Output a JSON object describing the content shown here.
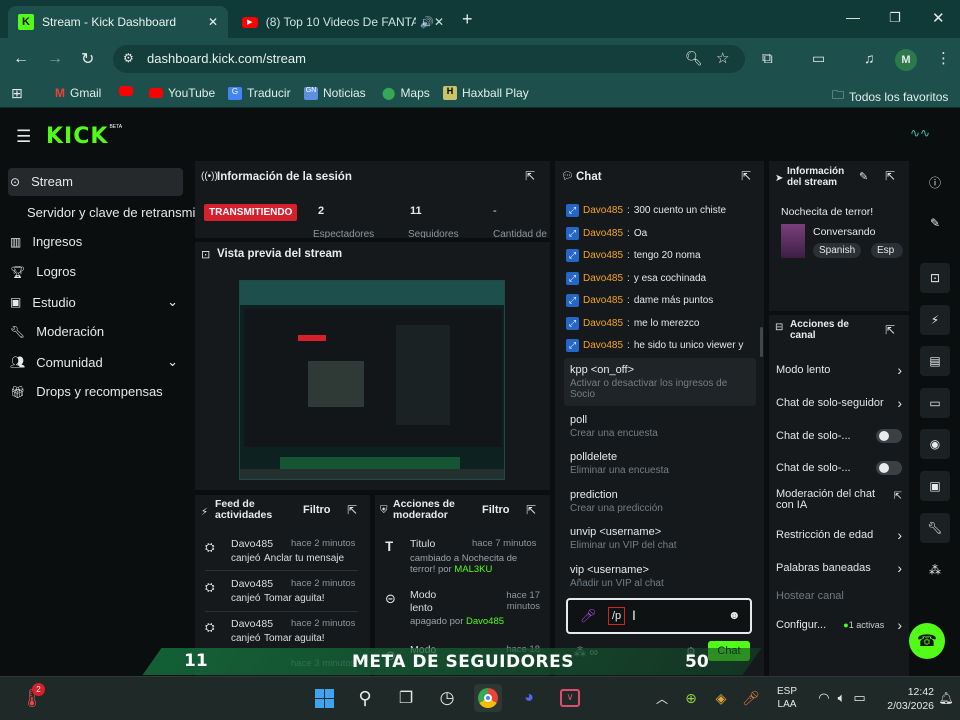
{
  "browser": {
    "tabs": [
      {
        "title": "Stream - Kick Dashboard"
      },
      {
        "title": "(8) Top 10 Videos De FANTA"
      }
    ],
    "url": "dashboard.kick.com/stream",
    "profile_initial": "M",
    "bookmarks": [
      "Gmail",
      "YouTube",
      "Traducir",
      "Noticias",
      "Maps",
      "Haxball Play"
    ],
    "all_bookmarks_label": "Todos los favoritos"
  },
  "kick": {
    "logo": "KICK",
    "logo_badge": "BETA",
    "sidebar": {
      "items": [
        {
          "label": "Stream",
          "icon": "play-icon"
        },
        {
          "label": "Servidor y clave de retransmisión",
          "icon": ""
        },
        {
          "label": "Ingresos",
          "icon": "chart-icon"
        },
        {
          "label": "Logros",
          "icon": "trophy-icon"
        },
        {
          "label": "Estudio",
          "icon": "video-icon"
        },
        {
          "label": "Moderación",
          "icon": "wrench-icon"
        },
        {
          "label": "Comunidad",
          "icon": "people-icon"
        },
        {
          "label": "Drops y recompensas",
          "icon": "gift-icon"
        }
      ]
    },
    "session": {
      "title": "Información de la sesión",
      "status": "TRANSMITIENDO",
      "stats": [
        {
          "value": "2",
          "label": "Espectadores"
        },
        {
          "value": "11",
          "label": "Seguidores"
        },
        {
          "value": "-",
          "label": "Cantidad de"
        }
      ]
    },
    "preview": {
      "title": "Vista previa del stream"
    },
    "chat": {
      "title": "Chat",
      "messages": [
        {
          "user": "Davo485",
          "text": "300 cuento un chiste"
        },
        {
          "user": "Davo485",
          "text": "Oa"
        },
        {
          "user": "Davo485",
          "text": "tengo 20 noma"
        },
        {
          "user": "Davo485",
          "text": "y esa cochinada"
        },
        {
          "user": "Davo485",
          "text": "dame más puntos"
        },
        {
          "user": "Davo485",
          "text": "me lo merezco"
        },
        {
          "user": "Davo485",
          "text": "he sido tu unico viewer y"
        }
      ],
      "commands": [
        {
          "name": "kpp <on_off>",
          "desc": "Activar o desactivar los ingresos de Socio"
        },
        {
          "name": "poll",
          "desc": "Crear una encuesta"
        },
        {
          "name": "polldelete",
          "desc": "Eliminar una encuesta"
        },
        {
          "name": "prediction",
          "desc": "Crear una predicción"
        },
        {
          "name": "unvip <username>",
          "desc": "Eliminar un VIP del chat"
        },
        {
          "name": "vip <username>",
          "desc": "Añadir un VIP al chat"
        }
      ],
      "input_value": "/p",
      "send_label": "Chat"
    },
    "stream_info": {
      "title": "Información del stream",
      "stream_title": "Nochecita de terror!",
      "category": "Conversando",
      "tags": [
        "Spanish",
        "Esp"
      ]
    },
    "channel_actions": {
      "title": "Acciones de canal",
      "items": [
        {
          "label": "Modo lento",
          "control": "chevron"
        },
        {
          "label": "Chat de solo-seguidores",
          "control": "chevron"
        },
        {
          "label": "Chat de solo-...",
          "control": "toggle"
        },
        {
          "label": "Chat de solo-...",
          "control": "toggle"
        },
        {
          "label": "Moderación del chat con IA",
          "control": "external"
        },
        {
          "label": "Restricción de edad",
          "control": "chevron"
        },
        {
          "label": "Palabras baneadas",
          "control": "chevron"
        },
        {
          "label": "Hostear canal",
          "control": "none"
        },
        {
          "label": "Configur...",
          "control": "chevron",
          "badge": "1 activas"
        }
      ]
    },
    "activity_feed": {
      "title": "Feed de actividades",
      "filter": "Filtro",
      "items": [
        {
          "user": "Davo485",
          "time": "hace 2 minutos",
          "action": "canjeó",
          "reward": "Anclar tu mensaje"
        },
        {
          "user": "Davo485",
          "time": "hace 2 minutos",
          "action": "canjeó",
          "reward": "Tomar aguita!"
        },
        {
          "user": "Davo485",
          "time": "hace 2 minutos",
          "action": "canjeó",
          "reward": "Tomar aguita!"
        },
        {
          "user": "",
          "time": "hace 3 minutos",
          "action": "",
          "reward": ""
        }
      ]
    },
    "mod_actions": {
      "title": "Acciones de moderador",
      "filter": "Filtro",
      "items": [
        {
          "label": "Titulo",
          "time": "hace 7 minutos",
          "detail": "cambiado a Nochecita de terror! por",
          "by": "MAL3KU"
        },
        {
          "label": "Modo lento",
          "time": "hace 17 minutos",
          "detail": "apagado por",
          "by": "Davo485"
        },
        {
          "label": "Modo",
          "time": "hace 18",
          "detail": "",
          "by": ""
        }
      ]
    },
    "overlay": {
      "left_value": "11",
      "title": "META DE SEGUIDORES",
      "right_value": "50"
    }
  },
  "taskbar": {
    "lang": "ESP",
    "lang2": "LAA",
    "time": "12:42",
    "date": "2/03/2026",
    "weather_badge": "2"
  },
  "colors": {
    "kick_green": "#53fc18",
    "live_red": "#d6202c",
    "chrome_teal": "#1d4f4c"
  }
}
